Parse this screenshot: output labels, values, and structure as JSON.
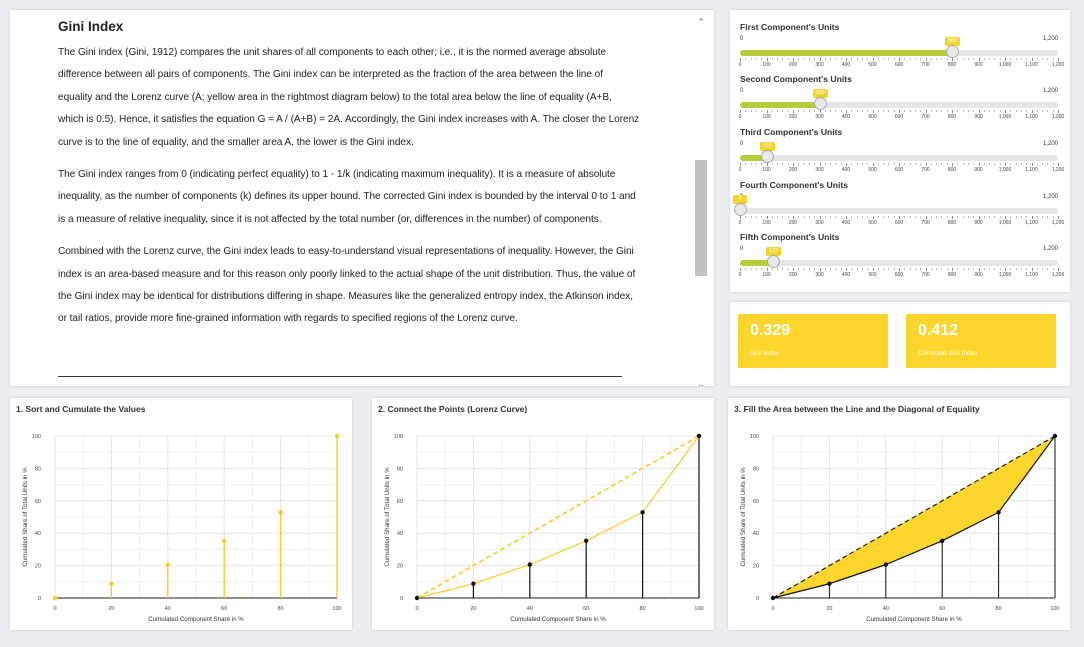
{
  "article": {
    "title": "Gini Index",
    "paragraphs": [
      "The Gini index (Gini, 1912) compares the unit shares of all components to each other; i.e., it is the normed average absolute difference between all pairs of components. The Gini index can be interpreted as the fraction of the area between the line of equality and the Lorenz curve (A; yellow area in the rightmost diagram below) to the total area below the line of equality (A+B, which is 0.5). Hence, it satisfies the equation G = A / (A+B) = 2A. Accordingly, the Gini index increases with A. The closer the Lorenz curve is to the line of equality, and the smaller area A, the lower is the Gini index.",
      "The Gini index ranges from 0 (indicating perfect equality) to 1 - 1/k (indicating maximum inequality). It is a measure of absolute inequality, as the number of components (k) defines its upper bound. The corrected Gini index is bounded by the interval 0 to 1 and is a measure of relative inequality, since it is not affected by the total number (or, differences in the number) of components.",
      "Combined with the Lorenz curve, the Gini index leads to easy-to-understand visual representations of inequality. However, the Gini index is an area-based measure and for this reason only poorly linked to the actual shape of the unit distribution. Thus, the value of the Gini index may be identical for distributions differing in shape. Measures like the generalized entropy index, the Atkinson index, or tail ratios, provide more fine-grained information with regards to specified regions of the Lorenz curve."
    ]
  },
  "scrollbar": {
    "up_glyph": "⌃",
    "down_glyph": "⌄"
  },
  "sliders": [
    {
      "label": "First Component's Units",
      "value": 800,
      "value_text": "800"
    },
    {
      "label": "Second Component's Units",
      "value": 300,
      "value_text": "300"
    },
    {
      "label": "Third Component's Units",
      "value": 100,
      "value_text": "100"
    },
    {
      "label": "Fourth Component's Units",
      "value": 0,
      "value_text": "0"
    },
    {
      "label": "Fifth Component's Units",
      "value": 125,
      "value_text": "125"
    }
  ],
  "slider_scale": {
    "min": 0,
    "max": 1200,
    "min_label": "0",
    "max_label": "1,200",
    "tick_labels": [
      "0",
      "100",
      "200",
      "300",
      "400",
      "500",
      "600",
      "700",
      "800",
      "900",
      "1,000",
      "1,100",
      "1,200"
    ]
  },
  "stats": {
    "gini": {
      "value": "0.329",
      "label": "Gini Index"
    },
    "corrected": {
      "value": "0.412",
      "label": "Corrected Gini Index"
    }
  },
  "colors": {
    "accent": "#fcd52d",
    "line": "#f5cc2a",
    "slider_fill": "#b6cc3a"
  },
  "charts": [
    {
      "title": "1. Sort and Cumulate the Values"
    },
    {
      "title": "2. Connect the Points (Lorenz Curve)"
    },
    {
      "title": "3. Fill the Area between the Line and the Diagonal of Equality"
    }
  ],
  "chart_data": [
    {
      "type": "bar",
      "title": "1. Sort and Cumulate the Values",
      "xlabel": "Cumulated Component Share in %",
      "ylabel": "Cumulated Share of Total Units in %",
      "x": [
        0,
        20,
        40,
        60,
        80,
        100
      ],
      "values": [
        0,
        8.8,
        20.6,
        35.3,
        52.9,
        100
      ],
      "xlim": [
        0,
        100
      ],
      "ylim": [
        0,
        100
      ],
      "xticks": [
        "0",
        "20",
        "40",
        "60",
        "80",
        "100"
      ],
      "yticks": [
        "0",
        "20",
        "40",
        "60",
        "80",
        "100"
      ],
      "grid": true
    },
    {
      "type": "line",
      "title": "2. Connect the Points (Lorenz Curve)",
      "xlabel": "Cumulated Component Share in %",
      "ylabel": "Cumulated Share of Total Units in %",
      "x": [
        0,
        20,
        40,
        60,
        80,
        100
      ],
      "series": [
        {
          "values": [
            0,
            8.8,
            20.6,
            35.3,
            52.9,
            100
          ]
        },
        {
          "values": [
            0,
            20,
            40,
            60,
            80,
            100
          ]
        }
      ],
      "xlim": [
        0,
        100
      ],
      "ylim": [
        0,
        100
      ],
      "xticks": [
        "0",
        "20",
        "40",
        "60",
        "80",
        "100"
      ],
      "yticks": [
        "0",
        "20",
        "40",
        "60",
        "80",
        "100"
      ],
      "grid": true
    },
    {
      "type": "area",
      "title": "3. Fill the Area between the Line and the Diagonal of Equality",
      "xlabel": "Cumulated Component Share in %",
      "ylabel": "Cumulated Share of Total Units in %",
      "x": [
        0,
        20,
        40,
        60,
        80,
        100
      ],
      "series": [
        {
          "values": [
            0,
            8.8,
            20.6,
            35.3,
            52.9,
            100
          ]
        },
        {
          "values": [
            0,
            20,
            40,
            60,
            80,
            100
          ]
        }
      ],
      "xlim": [
        0,
        100
      ],
      "ylim": [
        0,
        100
      ],
      "xticks": [
        "0",
        "20",
        "40",
        "60",
        "80",
        "100"
      ],
      "yticks": [
        "0",
        "20",
        "40",
        "60",
        "80",
        "100"
      ],
      "grid": true
    }
  ]
}
